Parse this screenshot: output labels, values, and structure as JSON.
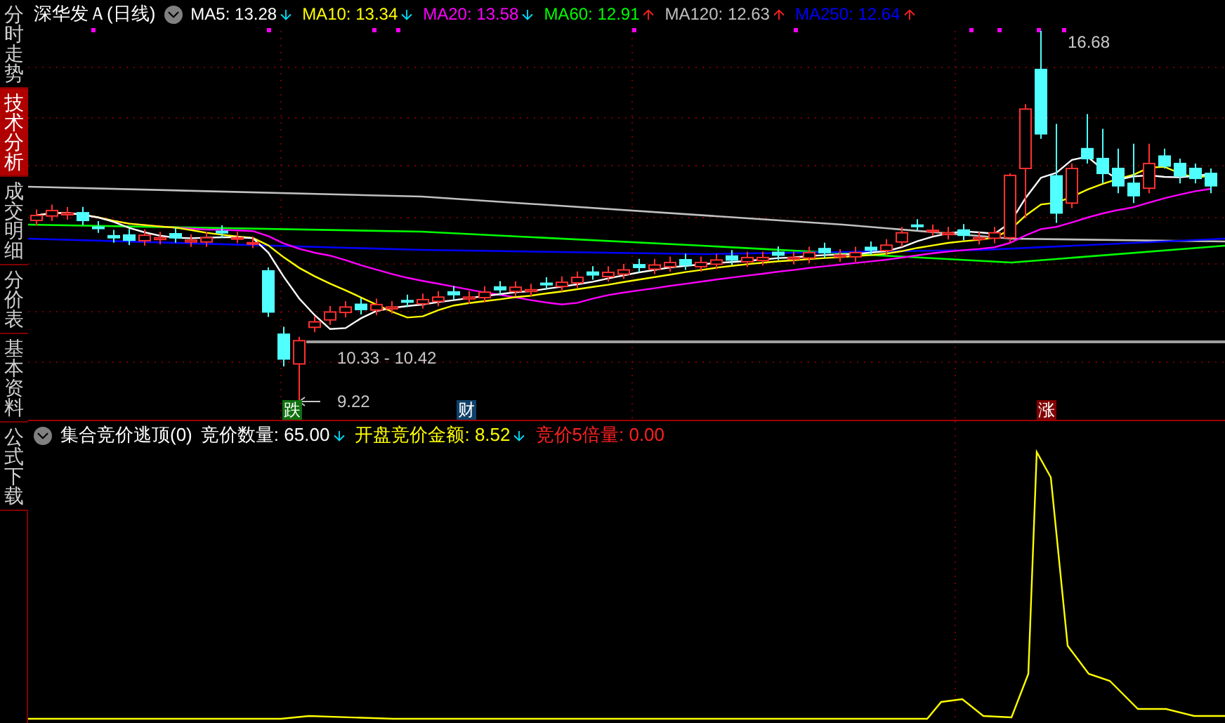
{
  "sidebar": {
    "tabs": [
      {
        "label": "分时走势",
        "selected": false
      },
      {
        "label": "技术分析",
        "selected": true
      },
      {
        "label": "成交明细",
        "selected": false
      },
      {
        "label": "分价表",
        "selected": false
      },
      {
        "label": "基本资料",
        "selected": false
      },
      {
        "label": "公式下载",
        "selected": false
      }
    ]
  },
  "price_chart": {
    "title": "深华发Ａ(日线)",
    "indicators": [
      {
        "name": "MA5:",
        "value": "13.28",
        "rising": false,
        "color": "#ffffff"
      },
      {
        "name": "MA10:",
        "value": "13.34",
        "rising": false,
        "color": "#ffff00"
      },
      {
        "name": "MA20:",
        "value": "13.58",
        "rising": false,
        "color": "#ff00ff"
      },
      {
        "name": "MA60:",
        "value": "12.91",
        "rising": true,
        "color": "#00ff00"
      },
      {
        "name": "MA120:",
        "value": "12.63",
        "rising": true,
        "color": "#c0c0c0"
      },
      {
        "name": "MA250:",
        "value": "12.64",
        "rising": true,
        "color": "#0000ff"
      }
    ],
    "price_labels": [
      {
        "kind": "high",
        "text": "16.68"
      },
      {
        "kind": "range",
        "text": "10.33 - 10.42"
      },
      {
        "kind": "low",
        "text": "9.22"
      }
    ],
    "event_tags": [
      {
        "text": "跌",
        "color": "#107010"
      },
      {
        "text": "财",
        "color": "#10406a"
      },
      {
        "text": "涨",
        "color": "#800000"
      }
    ]
  },
  "indicator_panel": {
    "title": "集合竞价逃顶(0)",
    "values": [
      {
        "label": "竞价数量:",
        "value": "65.00",
        "rising": false,
        "color": "#ffffff"
      },
      {
        "label": "开盘竞价金额:",
        "value": "8.52",
        "rising": false,
        "color": "#ffff00"
      },
      {
        "label": "竞价5倍量:",
        "value": "0.00",
        "color": "#ff2020"
      }
    ]
  }
}
